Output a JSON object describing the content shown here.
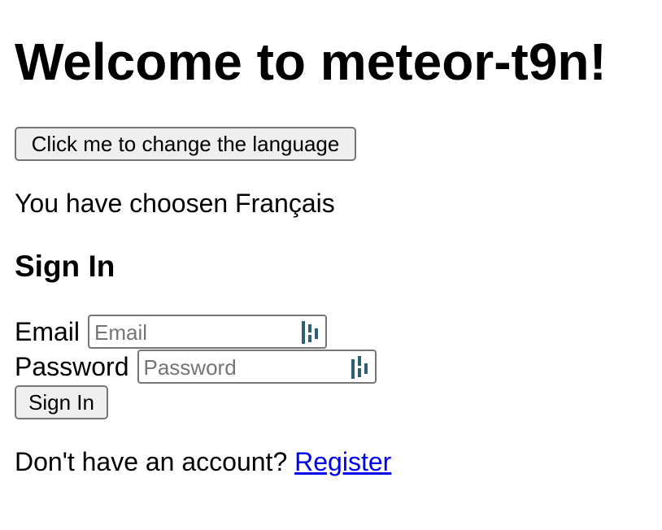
{
  "header": {
    "title": "Welcome to meteor-t9n!"
  },
  "language": {
    "button_label": "Click me to change the language",
    "chosen_text": "You have choosen Français"
  },
  "sign_in": {
    "heading": "Sign In",
    "email": {
      "label": "Email",
      "placeholder": "Email",
      "value": ""
    },
    "password": {
      "label": "Password",
      "placeholder": "Password",
      "value": ""
    },
    "submit_label": "Sign In",
    "password_manager_icon": "password-manager-icon",
    "password_manager_color": "#2e5f73"
  },
  "footer": {
    "prompt": "Don't have an account? ",
    "register_link": "Register"
  }
}
